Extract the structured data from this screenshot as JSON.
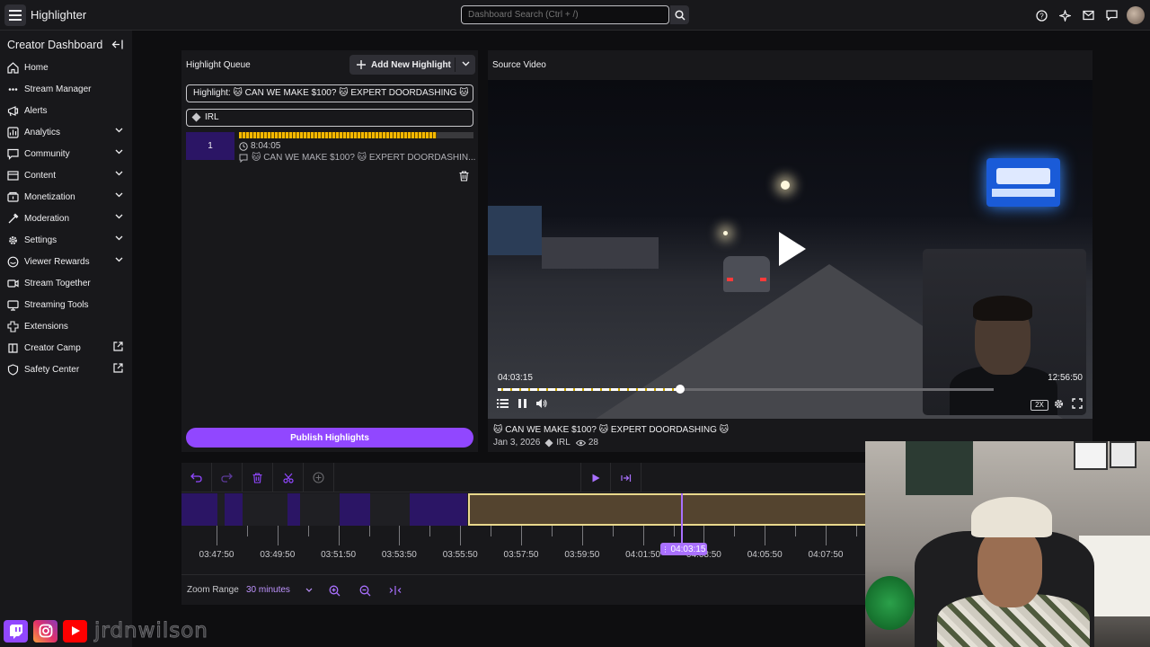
{
  "app": {
    "title": "Highlighter"
  },
  "search": {
    "placeholder": "Dashboard Search (Ctrl + /)"
  },
  "top_icons": [
    "help-icon",
    "sparkle-icon",
    "inbox-icon",
    "whispers-icon",
    "avatar"
  ],
  "sidebar": {
    "header": "Creator Dashboard",
    "items": [
      {
        "label": "Home",
        "icon": "home-icon",
        "chevron": false,
        "external": false
      },
      {
        "label": "Stream Manager",
        "icon": "stream-manager-icon",
        "chevron": false,
        "external": false
      },
      {
        "label": "Alerts",
        "icon": "alerts-icon",
        "chevron": false,
        "external": false
      },
      {
        "label": "Analytics",
        "icon": "analytics-icon",
        "chevron": true,
        "external": false
      },
      {
        "label": "Community",
        "icon": "community-icon",
        "chevron": true,
        "external": false
      },
      {
        "label": "Content",
        "icon": "content-icon",
        "chevron": true,
        "external": false
      },
      {
        "label": "Monetization",
        "icon": "monetization-icon",
        "chevron": true,
        "external": false
      },
      {
        "label": "Moderation",
        "icon": "moderation-icon",
        "chevron": true,
        "external": false
      },
      {
        "label": "Settings",
        "icon": "settings-icon",
        "chevron": true,
        "external": false
      },
      {
        "label": "Viewer Rewards",
        "icon": "viewer-rewards-icon",
        "chevron": true,
        "external": false
      },
      {
        "label": "Stream Together",
        "icon": "stream-together-icon",
        "chevron": false,
        "external": false
      },
      {
        "label": "Streaming Tools",
        "icon": "streaming-tools-icon",
        "chevron": false,
        "external": false
      },
      {
        "label": "Extensions",
        "icon": "extensions-icon",
        "chevron": false,
        "external": false
      },
      {
        "label": "Creator Camp",
        "icon": "creator-camp-icon",
        "chevron": false,
        "external": true
      },
      {
        "label": "Safety Center",
        "icon": "safety-center-icon",
        "chevron": false,
        "external": true
      }
    ]
  },
  "queue": {
    "title": "Highlight Queue",
    "add_label": "Add New Highlight",
    "highlight_field": "Highlight: 🐱 CAN WE MAKE $100? 🐱 EXPERT DOORDASHING 🐱",
    "category_field": "IRL",
    "item": {
      "number": "1",
      "duration": "8:04:05",
      "title": "🐱 CAN WE MAKE $100? 🐱 EXPERT DOORDASHIN..."
    },
    "publish_label": "Publish Highlights"
  },
  "video": {
    "title": "Source Video",
    "current_time": "04:03:15",
    "end_time": "12:56:50",
    "progress_fraction": 0.3676,
    "played_fraction": 0.3676,
    "speed_label": "2X",
    "caption": "🐱 CAN WE MAKE $100? 🐱 EXPERT DOORDASHING 🐱",
    "date": "Jan 3, 2026",
    "category": "IRL",
    "viewers": "28"
  },
  "timeline": {
    "playhead_label": "04:03:15",
    "ticks": [
      "03:47:50",
      "03:49:50",
      "03:51:50",
      "03:53:50",
      "03:55:50",
      "03:57:50",
      "03:59:50",
      "04:01:50",
      "04:03:50",
      "04:05:50",
      "04:07:50"
    ],
    "zoom_label": "Zoom Range",
    "zoom_value": "30 minutes"
  },
  "overlay": {
    "handle": "jrdnwilson"
  },
  "colors": {
    "accent": "#9147ff",
    "playhead": "#a970ff",
    "highlight_bar": "#f5b800"
  }
}
